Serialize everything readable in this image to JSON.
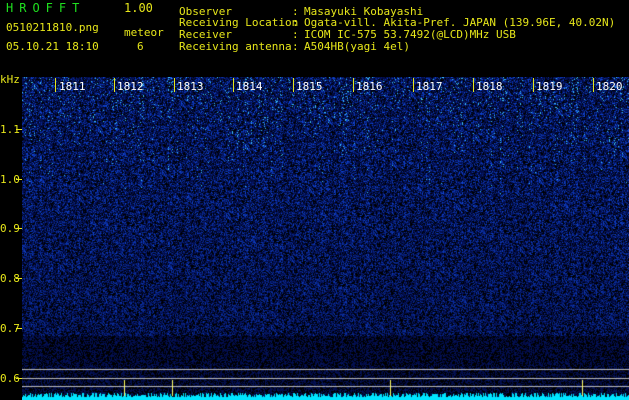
{
  "header": {
    "app_title": "HROFFT",
    "version": "1.00",
    "filename": "0510211810.png",
    "datetime": "05.10.21 18:10",
    "meteor_label": "meteor",
    "meteor_count": "6"
  },
  "info": [
    {
      "label": "Observer",
      "value": "Masayuki Kobayashi"
    },
    {
      "label": "Receiving Location",
      "value": "Ogata-vill. Akita-Pref. JAPAN (139.96E, 40.02N)"
    },
    {
      "label": "Receiver",
      "value": "ICOM IC-575 53.7492(@LCD)MHz USB"
    },
    {
      "label": "Receiving antenna",
      "value": "A504HB(yagi 4el)"
    }
  ],
  "spectrogram": {
    "freq_unit": "kHz",
    "freq_ticks": [
      "1.1",
      "1.0",
      "0.9",
      "0.8",
      "0.7",
      "0.6"
    ],
    "time_ticks": [
      "1811",
      "1812",
      "1813",
      "1814",
      "1815",
      "1816",
      "1817",
      "1818",
      "1819",
      "1820"
    ],
    "colors": {
      "background": "#000000",
      "signal_low": "#0a1a6e",
      "signal_high": "#1f5cff",
      "trace": "#00e5ff",
      "label": "#e6e61a"
    }
  }
}
